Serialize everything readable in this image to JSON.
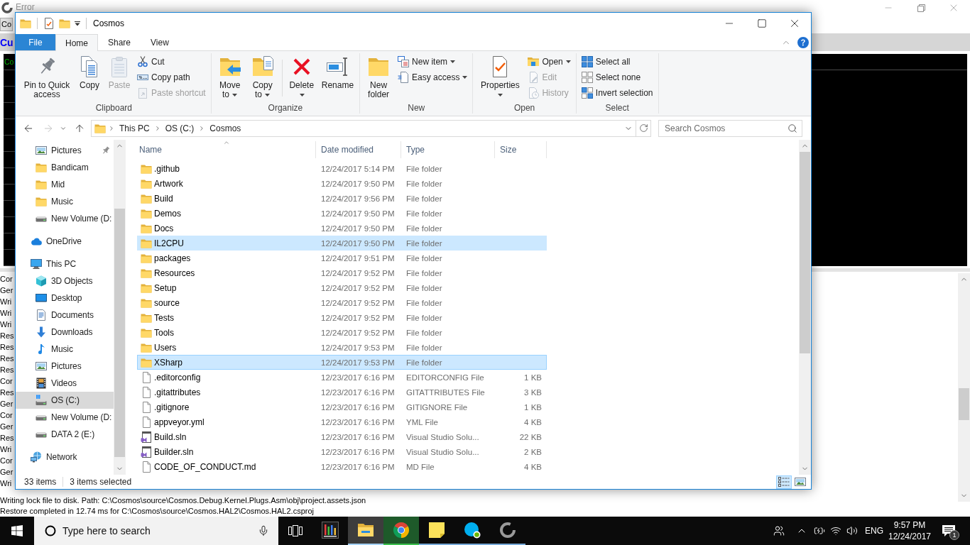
{
  "background_window": {
    "title": "Error",
    "toolbar_button": "Co",
    "banner": "Cu",
    "console_text": "Co",
    "log_lines": [
      "Cor",
      "Ger",
      "Wri",
      "Wri",
      "Wri",
      "Res",
      "Res",
      "Res",
      "Res",
      "Cor",
      "Res",
      "Ger",
      "Cor",
      "Ger",
      "Res",
      "Wri",
      "Cor",
      "Ger",
      "Wri",
      "Writing lock file to disk. Path: C:\\Cosmos\\source\\Cosmos.Debug.Kernel.Plugs.Asm\\obj\\project.assets.json",
      "Restore completed in 12.74 ms for C:\\Cosmos\\source\\Cosmos.HAL2\\Cosmos.HAL2.csproj"
    ]
  },
  "explorer": {
    "title": "Cosmos",
    "ribbon_tabs": [
      {
        "label": "File",
        "kind": "file",
        "selected": false
      },
      {
        "label": "Home",
        "kind": "tab",
        "selected": true
      },
      {
        "label": "Share",
        "kind": "tab",
        "selected": false
      },
      {
        "label": "View",
        "kind": "tab",
        "selected": false
      }
    ],
    "ribbon_groups": [
      {
        "label": "Clipboard",
        "columns": [
          {
            "kind": "large",
            "buttons": [
              {
                "kind": "pin",
                "label": "Pin to Quick access",
                "dropdown": false,
                "disabled": false
              }
            ]
          },
          {
            "kind": "large",
            "buttons": [
              {
                "kind": "copy",
                "label": "Copy",
                "dropdown": false,
                "disabled": false
              }
            ]
          },
          {
            "kind": "large",
            "buttons": [
              {
                "kind": "paste",
                "label": "Paste",
                "dropdown": false,
                "disabled": true
              }
            ]
          },
          {
            "kind": "small",
            "buttons": [
              {
                "kind": "cut",
                "label": "Cut",
                "dropdown": false,
                "disabled": false
              },
              {
                "kind": "copypath",
                "label": "Copy path",
                "dropdown": false,
                "disabled": false
              },
              {
                "kind": "shortcut",
                "label": "Paste shortcut",
                "dropdown": false,
                "disabled": true
              }
            ]
          }
        ]
      },
      {
        "label": "Organize",
        "columns": [
          {
            "kind": "large",
            "buttons": [
              {
                "kind": "move",
                "label": "Move to",
                "dropdown": true,
                "disabled": false
              }
            ]
          },
          {
            "kind": "large",
            "buttons": [
              {
                "kind": "copyto",
                "label": "Copy to",
                "dropdown": true,
                "disabled": false
              }
            ]
          },
          {
            "kind": "separator"
          },
          {
            "kind": "large",
            "buttons": [
              {
                "kind": "delete",
                "label": "Delete",
                "dropdown": true,
                "disabled": false
              }
            ]
          },
          {
            "kind": "large",
            "buttons": [
              {
                "kind": "rename",
                "label": "Rename",
                "dropdown": false,
                "disabled": false
              }
            ]
          }
        ]
      },
      {
        "label": "New",
        "columns": [
          {
            "kind": "large",
            "buttons": [
              {
                "kind": "newfolder",
                "label": "New folder",
                "dropdown": false,
                "disabled": false
              }
            ]
          },
          {
            "kind": "small",
            "buttons": [
              {
                "kind": "newitem",
                "label": "New item",
                "dropdown": true,
                "disabled": false
              },
              {
                "kind": "easyaccess",
                "label": "Easy access",
                "dropdown": true,
                "disabled": false
              }
            ]
          }
        ]
      },
      {
        "label": "Open",
        "columns": [
          {
            "kind": "large",
            "buttons": [
              {
                "kind": "properties",
                "label": "Properties",
                "dropdown": true,
                "disabled": false
              }
            ]
          },
          {
            "kind": "small",
            "buttons": [
              {
                "kind": "open",
                "label": "Open",
                "dropdown": true,
                "disabled": false
              },
              {
                "kind": "edit",
                "label": "Edit",
                "dropdown": false,
                "disabled": true
              },
              {
                "kind": "history",
                "label": "History",
                "dropdown": false,
                "disabled": true
              }
            ]
          }
        ]
      },
      {
        "label": "Select",
        "columns": [
          {
            "kind": "small",
            "buttons": [
              {
                "kind": "selectall",
                "label": "Select all",
                "dropdown": false,
                "disabled": false
              },
              {
                "kind": "selectnone",
                "label": "Select none",
                "dropdown": false,
                "disabled": false
              },
              {
                "kind": "invert",
                "label": "Invert selection",
                "dropdown": false,
                "disabled": false
              }
            ]
          }
        ]
      }
    ],
    "address": {
      "crumbs": [
        "This PC",
        "OS (C:)",
        "Cosmos"
      ]
    },
    "search": {
      "placeholder": "Search Cosmos"
    },
    "nav_tree": [
      {
        "children": [
          {
            "label": "Pictures",
            "kind": "pictures",
            "pinned": true,
            "selected": false
          },
          {
            "label": "Bandicam",
            "kind": "folder",
            "pinned": false,
            "selected": false
          },
          {
            "label": "Mid",
            "kind": "folder",
            "pinned": false,
            "selected": false
          },
          {
            "label": "Music",
            "kind": "folder",
            "pinned": false,
            "selected": false
          },
          {
            "label": "New Volume (D:",
            "kind": "drive",
            "pinned": false,
            "selected": false
          }
        ]
      },
      {
        "label": "OneDrive",
        "kind": "cloud",
        "selected": false
      },
      {
        "label": "This PC",
        "kind": "pc",
        "selected": false,
        "children": [
          {
            "label": "3D Objects",
            "kind": "cube",
            "selected": false
          },
          {
            "label": "Desktop",
            "kind": "desktop",
            "selected": false
          },
          {
            "label": "Documents",
            "kind": "documents",
            "selected": false
          },
          {
            "label": "Downloads",
            "kind": "downloads",
            "selected": false
          },
          {
            "label": "Music",
            "kind": "music",
            "selected": false
          },
          {
            "label": "Pictures",
            "kind": "pictures",
            "selected": false
          },
          {
            "label": "Videos",
            "kind": "videos",
            "selected": false
          },
          {
            "label": "OS (C:)",
            "kind": "osdrive",
            "selected": true
          },
          {
            "label": "New Volume (D:",
            "kind": "drive",
            "selected": false
          },
          {
            "label": "DATA 2 (E:)",
            "kind": "drive",
            "selected": false
          }
        ]
      },
      {
        "label": "Network",
        "kind": "network",
        "selected": false
      }
    ],
    "file_list": {
      "columns": [
        {
          "label": "Name",
          "sorted": true
        },
        {
          "label": "Date modified",
          "sorted": false
        },
        {
          "label": "Type",
          "sorted": false
        },
        {
          "label": "Size",
          "sorted": false
        }
      ],
      "rows": [
        {
          "name": ".github",
          "kind": "folder",
          "date": "12/24/2017 5:14 PM",
          "type": "File folder",
          "selected": false,
          "focused": false
        },
        {
          "name": "Artwork",
          "kind": "folder",
          "date": "12/24/2017 9:50 PM",
          "type": "File folder",
          "selected": false,
          "focused": false
        },
        {
          "name": "Build",
          "kind": "folder",
          "date": "12/24/2017 9:56 PM",
          "type": "File folder",
          "selected": false,
          "focused": false
        },
        {
          "name": "Demos",
          "kind": "folder",
          "date": "12/24/2017 9:50 PM",
          "type": "File folder",
          "selected": false,
          "focused": false
        },
        {
          "name": "Docs",
          "kind": "folder",
          "date": "12/24/2017 9:50 PM",
          "type": "File folder",
          "selected": false,
          "focused": false
        },
        {
          "name": "IL2CPU",
          "kind": "folder",
          "date": "12/24/2017 9:50 PM",
          "type": "File folder",
          "selected": true,
          "focused": false
        },
        {
          "name": "packages",
          "kind": "folder",
          "date": "12/24/2017 9:51 PM",
          "type": "File folder",
          "selected": false,
          "focused": false
        },
        {
          "name": "Resources",
          "kind": "folder",
          "date": "12/24/2017 9:52 PM",
          "type": "File folder",
          "selected": false,
          "focused": false
        },
        {
          "name": "Setup",
          "kind": "folder",
          "date": "12/24/2017 9:52 PM",
          "type": "File folder",
          "selected": false,
          "focused": false
        },
        {
          "name": "source",
          "kind": "folder",
          "date": "12/24/2017 9:52 PM",
          "type": "File folder",
          "selected": false,
          "focused": false
        },
        {
          "name": "Tests",
          "kind": "folder",
          "date": "12/24/2017 9:52 PM",
          "type": "File folder",
          "selected": false,
          "focused": false
        },
        {
          "name": "Tools",
          "kind": "folder",
          "date": "12/24/2017 9:52 PM",
          "type": "File folder",
          "selected": false,
          "focused": false
        },
        {
          "name": "Users",
          "kind": "folder",
          "date": "12/24/2017 9:53 PM",
          "type": "File folder",
          "selected": false,
          "focused": false
        },
        {
          "name": "XSharp",
          "kind": "folder",
          "date": "12/24/2017 9:53 PM",
          "type": "File folder",
          "selected": true,
          "focused": true
        },
        {
          "name": ".editorconfig",
          "kind": "file",
          "date": "12/23/2017 6:16 PM",
          "type": "EDITORCONFIG File",
          "size": "1 KB",
          "selected": false,
          "focused": false
        },
        {
          "name": ".gitattributes",
          "kind": "file",
          "date": "12/23/2017 6:16 PM",
          "type": "GITATTRIBUTES File",
          "size": "3 KB",
          "selected": false,
          "focused": false
        },
        {
          "name": ".gitignore",
          "kind": "file",
          "date": "12/23/2017 6:16 PM",
          "type": "GITIGNORE File",
          "size": "1 KB",
          "selected": false,
          "focused": false
        },
        {
          "name": "appveyor.yml",
          "kind": "file",
          "date": "12/23/2017 6:16 PM",
          "type": "YML File",
          "size": "4 KB",
          "selected": false,
          "focused": false
        },
        {
          "name": "Build.sln",
          "kind": "solution",
          "date": "12/23/2017 6:16 PM",
          "type": "Visual Studio Solu...",
          "size": "22 KB",
          "selected": false,
          "focused": false
        },
        {
          "name": "Builder.sln",
          "kind": "solution",
          "date": "12/23/2017 6:16 PM",
          "type": "Visual Studio Solu...",
          "size": "2 KB",
          "selected": false,
          "focused": false
        },
        {
          "name": "CODE_OF_CONDUCT.md",
          "kind": "file",
          "date": "12/23/2017 6:16 PM",
          "type": "MD File",
          "size": "4 KB",
          "selected": false,
          "focused": false
        }
      ]
    },
    "status_bar": {
      "item_count": "33 items",
      "selection": "3 items selected",
      "views": [
        {
          "kind": "details",
          "selected": true
        },
        {
          "kind": "icons",
          "selected": false
        }
      ]
    }
  },
  "taskbar": {
    "search": {
      "placeholder": "Type here to search"
    },
    "apps": [
      {
        "kind": "bars",
        "running": false,
        "active": false,
        "flashing": false
      },
      {
        "kind": "explorer",
        "running": true,
        "active": true,
        "flashing": false
      },
      {
        "kind": "browser",
        "running": true,
        "active": false,
        "flashing": true
      },
      {
        "kind": "notes",
        "running": true,
        "active": false,
        "flashing": false
      },
      {
        "kind": "chat",
        "running": true,
        "active": false,
        "flashing": false
      },
      {
        "kind": "ring",
        "running": true,
        "active": false,
        "flashing": false
      }
    ],
    "tray": {
      "language": "ENG",
      "time": "9:57 PM",
      "date": "12/24/2017",
      "notifications": "1"
    }
  }
}
